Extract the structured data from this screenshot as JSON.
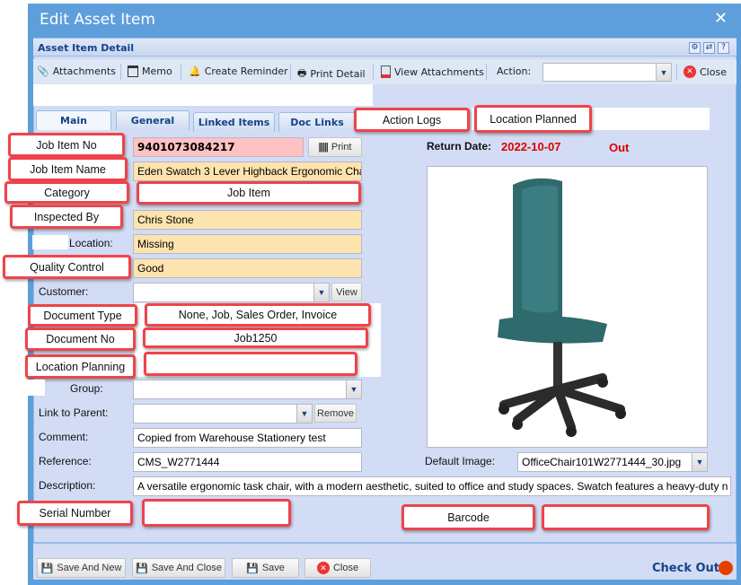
{
  "window": {
    "title": "Edit Asset Item"
  },
  "panel": {
    "title": "Asset Item Detail"
  },
  "toolbar": {
    "attachments": "Attachments",
    "memo": "Memo",
    "create_reminder": "Create Reminder",
    "print_detail": "Print Detail",
    "view_attachments": "View Attachments",
    "action_label": "Action:",
    "action_value": "",
    "close": "Close"
  },
  "tabs": [
    {
      "label": "Main"
    },
    {
      "label": "General"
    },
    {
      "label": "Linked Items"
    },
    {
      "label": "Doc Links"
    },
    {
      "label": "Action Logs"
    },
    {
      "label": "Location Planned"
    }
  ],
  "form": {
    "job_item_no": {
      "label": "Job Item No",
      "value": "9401073084217",
      "print": "Print"
    },
    "job_item_name": {
      "label": "Job Item Name",
      "value": "Eden Swatch 3 Lever Highback Ergonomic Cha"
    },
    "category": {
      "label": "Category",
      "value": "Job Item"
    },
    "inspected_by": {
      "label": "Inspected By",
      "value": "Chris Stone"
    },
    "location": {
      "label": "Location:",
      "value": "Missing"
    },
    "quality_control": {
      "label": "Quality Control",
      "value": "Good"
    },
    "customer": {
      "label": "Customer:",
      "value": "",
      "view": "View"
    },
    "document_type": {
      "label": "Document Type",
      "value": "None, Job, Sales Order, Invoice"
    },
    "document_no": {
      "label": "Document No",
      "value": "Job1250"
    },
    "location_planning": {
      "label": "Location Planning",
      "value": ""
    },
    "group": {
      "label": "Group:",
      "value": ""
    },
    "link_to_parent": {
      "label": "Link to Parent:",
      "value": "",
      "remove": "Remove"
    },
    "comment": {
      "label": "Comment:",
      "value": "Copied from Warehouse Stationery test"
    },
    "reference": {
      "label": "Reference:",
      "value": "CMS_W2771444"
    },
    "description": {
      "label": "Description:",
      "value": "A versatile ergonomic task chair, with a modern aesthetic, suited to office and study spaces. Swatch features a heavy-duty n"
    },
    "serial_number": {
      "label": "Serial Number",
      "value": ""
    },
    "barcode": {
      "label": "Barcode",
      "value": ""
    },
    "return_date": {
      "label": "Return Date:",
      "value": "2022-10-07",
      "status": "Out"
    },
    "default_image": {
      "label": "Default Image:",
      "value": "OfficeChair101W2771444_30.jpg"
    }
  },
  "footer": {
    "save_and_new": "Save And New",
    "save_and_close": "Save And Close",
    "save": "Save",
    "close": "Close",
    "check_out": "Check Out"
  },
  "colors": {
    "title_bar": "#5e9edb",
    "panel": "#d2dcf4",
    "callout_border": "#f0434a",
    "required": "#ffc2c2",
    "highlight": "#fde3ad",
    "status_red": "#e00000",
    "check_out_dot": "#e34000"
  }
}
